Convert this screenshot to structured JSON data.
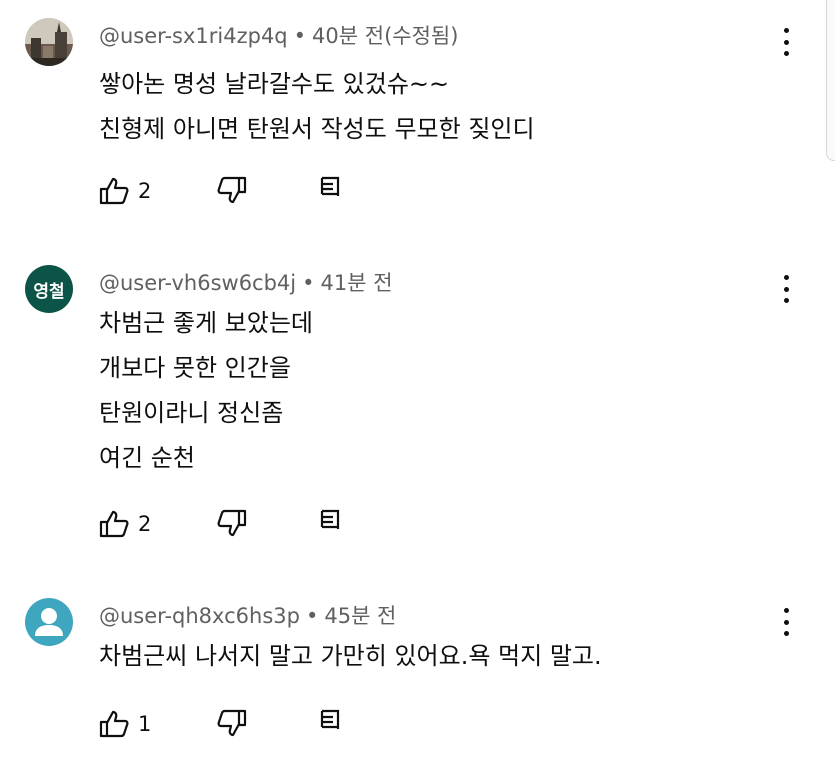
{
  "comments": [
    {
      "avatar_type": "photo",
      "username": "@user-sx1ri4zp4q",
      "time": "40분 전(수정됨)",
      "lines": [
        "쌓아논 명성 날라갈수도 있겄슈~~",
        "친형제 아니면 탄원서 작성도 무모한 짖인디"
      ],
      "likes": "2"
    },
    {
      "avatar_type": "text",
      "avatar_text": "영철",
      "avatar_color": "#0c5447",
      "username": "@user-vh6sw6cb4j",
      "time": "41분 전",
      "lines": [
        "차범근 좋게 보았는데",
        "개보다 못한 인간을",
        "탄원이라니 정신좀",
        "여긴 순천"
      ],
      "likes": "2"
    },
    {
      "avatar_type": "default",
      "avatar_color": "#3ea6be",
      "username": "@user-qh8xc6hs3p",
      "time": "45분 전",
      "lines": [
        "차범근씨 나서지 말고 가만히 있어요.욕 먹지 말고."
      ],
      "likes": "1"
    }
  ],
  "separator": "•",
  "icons": {
    "like": "thumb-up-icon",
    "dislike": "thumb-down-icon",
    "reply": "reply-icon",
    "more": "more-vert-icon"
  }
}
